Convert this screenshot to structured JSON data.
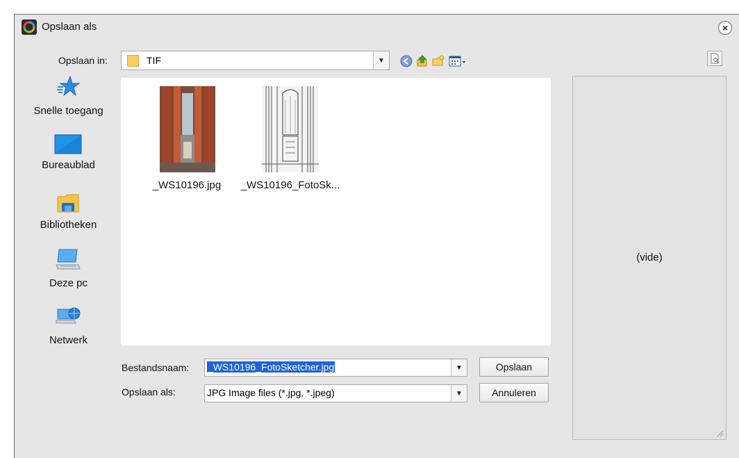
{
  "dialog": {
    "title": "Opslaan als",
    "close_label": "×"
  },
  "location": {
    "label": "Opslaan in:",
    "value": "TIF"
  },
  "toolbar": {
    "icons": [
      "back-icon",
      "up-folder-icon",
      "new-folder-icon",
      "view-menu-icon"
    ]
  },
  "places": [
    {
      "label": "Snelle toegang",
      "icon": "quick-access-star-icon"
    },
    {
      "label": "Bureaublad",
      "icon": "desktop-icon"
    },
    {
      "label": "Bibliotheken",
      "icon": "libraries-folder-icon"
    },
    {
      "label": "Deze pc",
      "icon": "computer-icon"
    },
    {
      "label": "Netwerk",
      "icon": "network-icon"
    }
  ],
  "files": [
    {
      "name": "_WS10196.jpg",
      "thumbnail": "color-photo-church-interior"
    },
    {
      "name": "_WS10196_FotoSk...",
      "thumbnail": "sketch-church-interior"
    }
  ],
  "form": {
    "filename_label": "Bestandsnaam:",
    "filename_value": "_WS10196_FotoSketcher.jpg",
    "filetype_label": "Opslaan als:",
    "filetype_value": "JPG Image files (*.jpg, *.jpeg)"
  },
  "buttons": {
    "save": "Opslaan",
    "cancel": "Annuleren"
  },
  "preview": {
    "empty_text": "(vide)"
  },
  "colors": {
    "dialog_bg": "#e6e6e6",
    "selection": "#1e63d8",
    "folder": "#f7cf64"
  }
}
